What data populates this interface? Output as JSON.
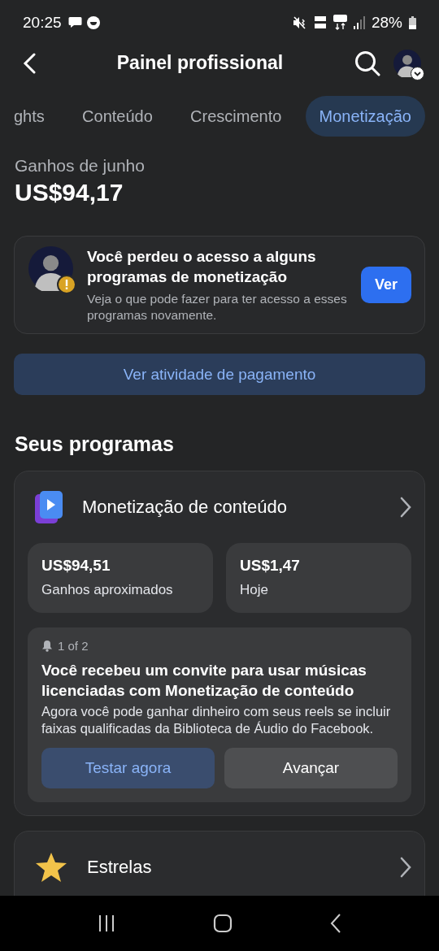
{
  "status_bar": {
    "time": "20:25",
    "battery": "28%"
  },
  "header": {
    "title": "Painel profissional"
  },
  "tabs": [
    {
      "label": "ghts",
      "selected": false
    },
    {
      "label": "Conteúdo",
      "selected": false
    },
    {
      "label": "Crescimento",
      "selected": false
    },
    {
      "label": "Monetização",
      "selected": true
    }
  ],
  "earnings": {
    "label": "Ganhos de junho",
    "amount": "US$94,17"
  },
  "alert": {
    "title": "Você perdeu o acesso a alguns programas de monetização",
    "body": "Veja o que pode fazer para ter acesso a esses programas novamente.",
    "button": "Ver"
  },
  "payment_button": "Ver atividade de pagamento",
  "programs": {
    "heading": "Seus programas",
    "items": [
      {
        "kind": "content",
        "title": "Monetização de conteúdo",
        "stats": [
          {
            "value": "US$94,51",
            "label": "Ganhos aproximados"
          },
          {
            "value": "US$1,47",
            "label": "Hoje"
          }
        ],
        "notice": {
          "counter": "1 of 2",
          "title": "Você recebeu um convite para usar músicas licenciadas com Monetização de conteúdo",
          "body": "Agora você pode ganhar dinheiro com seus reels se incluir faixas qualificadas da Biblioteca de Áudio do Facebook.",
          "buttons": [
            {
              "label": "Testar agora",
              "kind": "primary"
            },
            {
              "label": "Avançar",
              "kind": "secondary"
            }
          ]
        }
      },
      {
        "kind": "stars",
        "title": "Estrelas"
      }
    ]
  }
}
